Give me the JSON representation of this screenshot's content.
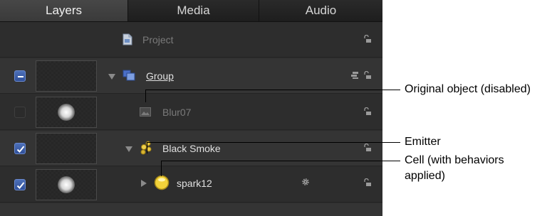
{
  "tabs": [
    {
      "label": "Layers",
      "active": true
    },
    {
      "label": "Media",
      "active": false
    },
    {
      "label": "Audio",
      "active": false
    }
  ],
  "layers": [
    {
      "name": "Project",
      "type": "project",
      "enabled": null
    },
    {
      "name": "Group",
      "type": "group",
      "enabled": "mixed"
    },
    {
      "name": "Blur07",
      "type": "image",
      "enabled": false
    },
    {
      "name": "Black Smoke",
      "type": "emitter",
      "enabled": true
    },
    {
      "name": "spark12",
      "type": "cell",
      "enabled": true
    }
  ],
  "callouts": {
    "original_object": "Original object (disabled)",
    "emitter": "Emitter",
    "cell_line1": "Cell (with behaviors",
    "cell_line2": "applied)"
  },
  "colors": {
    "panel_bg": "#2c2c2c",
    "checkbox_on": "#3e5fa8",
    "text_normal": "#e0e0e0",
    "text_dim": "#7a7a7a"
  },
  "icons": [
    "document-icon",
    "group-icon",
    "image-icon",
    "emitter-icon",
    "cell-icon",
    "lock-icon",
    "gear-icon",
    "stack-icon"
  ]
}
